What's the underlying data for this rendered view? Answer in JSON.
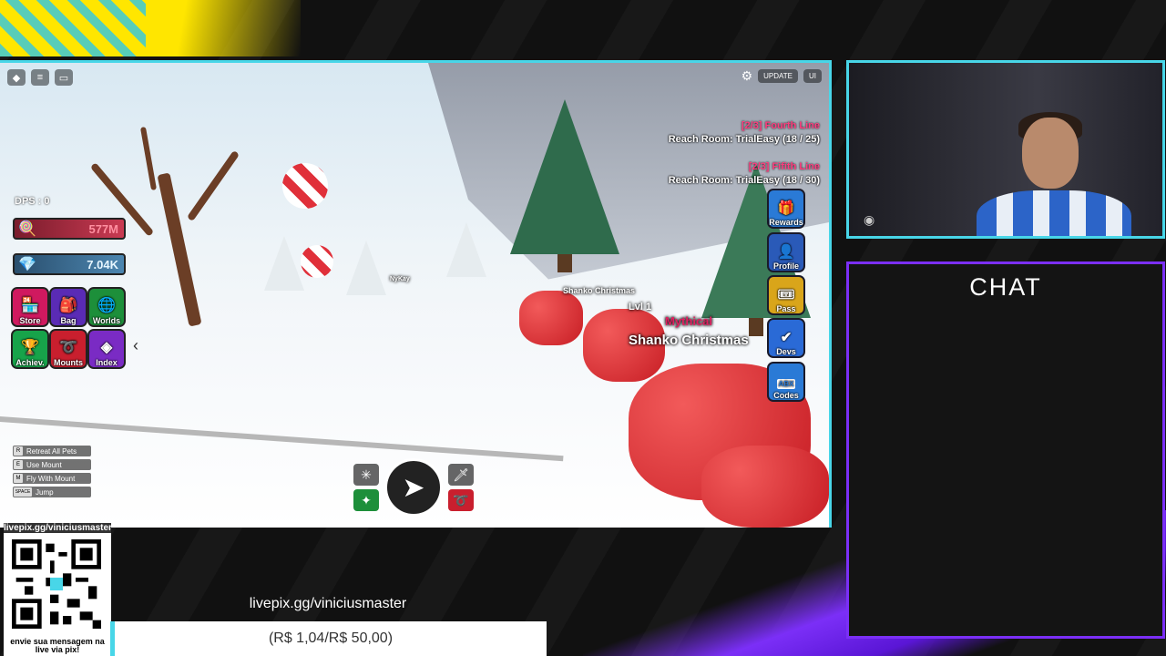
{
  "game": {
    "dps_label": "DPS : 0",
    "coins": "577M",
    "gems": "7.04K",
    "menu_buttons": [
      {
        "label": "Store",
        "icon": "store-icon",
        "color": "#d0195f"
      },
      {
        "label": "Bag",
        "icon": "bag-icon",
        "color": "#5a2bb5"
      },
      {
        "label": "Worlds",
        "icon": "globe-icon",
        "color": "#1d8f3a"
      },
      {
        "label": "Achiev.",
        "icon": "trophy-icon",
        "color": "#17a34a"
      },
      {
        "label": "Mounts",
        "icon": "mount-icon",
        "color": "#c91f2e"
      },
      {
        "label": "Index",
        "icon": "index-icon",
        "color": "#7a2bc4"
      }
    ],
    "top_right": {
      "update": "UPDATE",
      "ui": "UI"
    },
    "quests": [
      {
        "title": "[2/3] Fourth Line",
        "desc": "Reach Room: TrialEasy (18 / 25)"
      },
      {
        "title": "[2/3] Fifith Line",
        "desc": "Reach Room: TrialEasy (18 / 30)"
      }
    ],
    "side_buttons": [
      {
        "label": "Rewards",
        "icon": "gift-icon",
        "color": "#2a7ad6"
      },
      {
        "label": "Profile",
        "icon": "profile-icon",
        "color": "#2a5ab8"
      },
      {
        "label": "Pass",
        "icon": "ticket-icon",
        "color": "#d9a51a"
      },
      {
        "label": "Devs",
        "icon": "check-icon",
        "color": "#2a6ad6"
      },
      {
        "label": "Codes",
        "icon": "abx-icon",
        "color": "#2a7ad6",
        "badge": "ABX"
      }
    ],
    "key_hints": [
      {
        "key": "R",
        "label": "Retreat All Pets"
      },
      {
        "key": "E",
        "label": "Use Mount"
      },
      {
        "key": "M",
        "label": "Fly With Mount"
      },
      {
        "key": "SPACE",
        "label": "Jump"
      }
    ],
    "pet": {
      "level": "Lvl 1",
      "rarity": "Mythical",
      "name": "Shanko Christmas"
    },
    "pet_far_name": "Shanko Christmas",
    "player_name": "NyKay"
  },
  "stream": {
    "chat_title": "CHAT",
    "qr_url": "livepix.gg/viniciusmaster",
    "qr_caption": "envie sua mensagem na live via pix!",
    "livepix_url": "livepix.gg/viniciusmaster",
    "goal_text": "(R$ 1,04/R$ 50,00)",
    "accent": "#48d6e8",
    "purple": "#7b2ff7",
    "yellow": "#ffe600"
  }
}
